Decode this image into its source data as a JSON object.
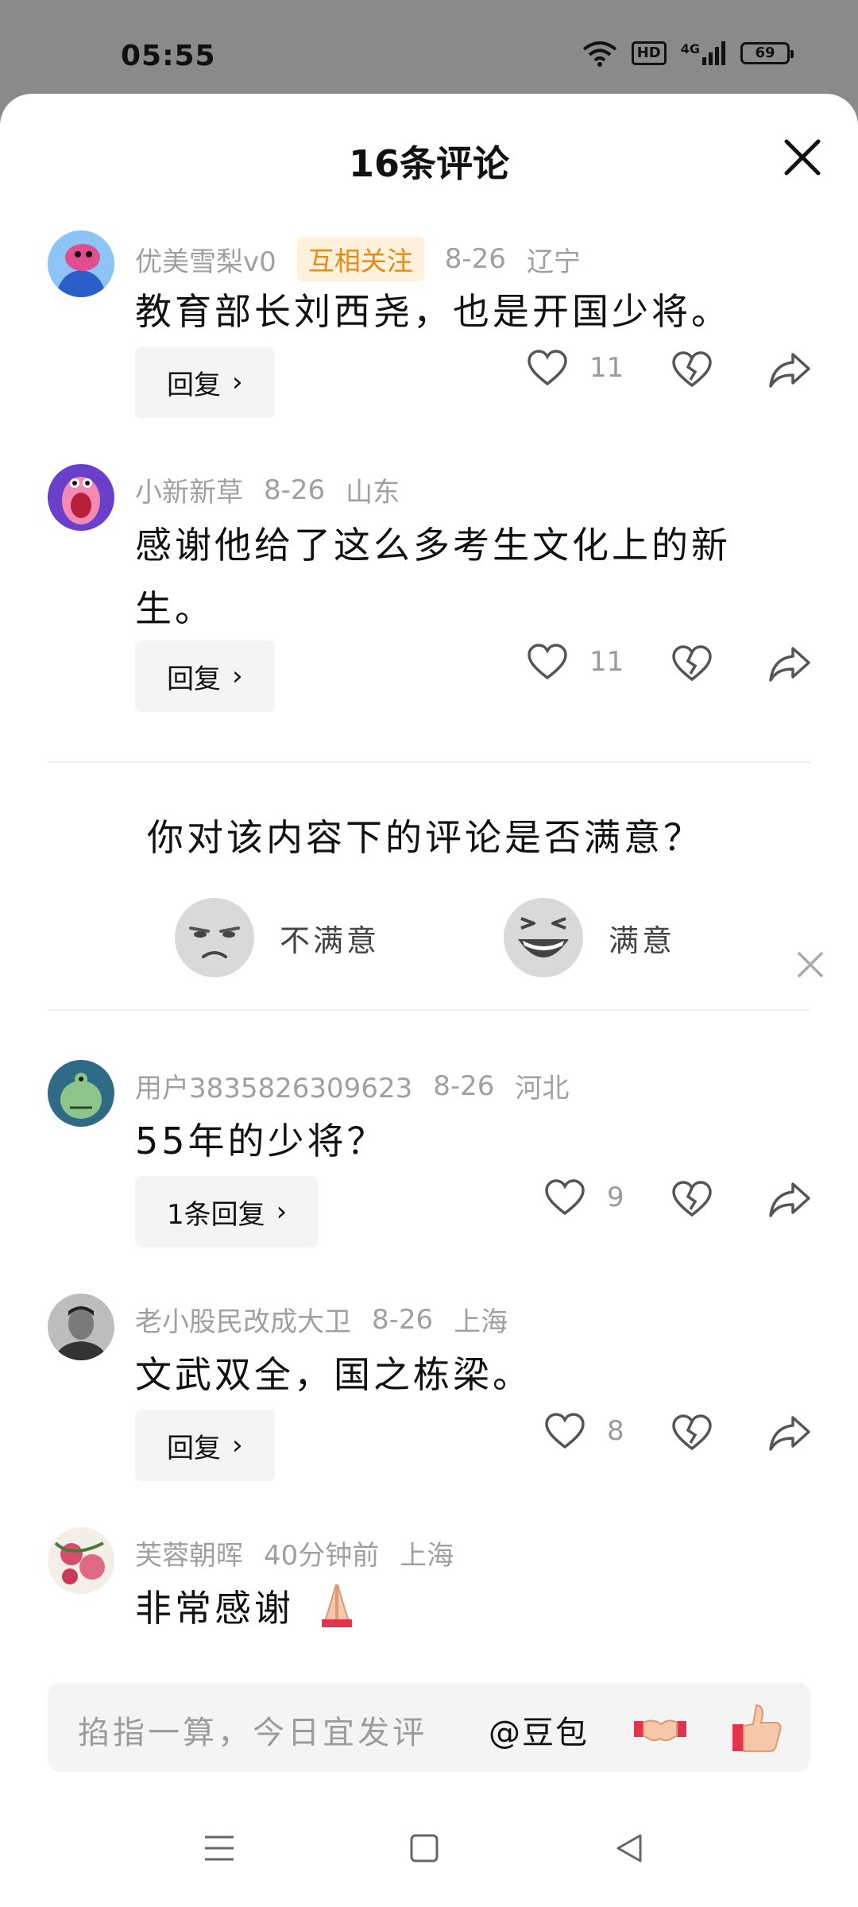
{
  "status_bar": {
    "time": "05:55",
    "hd": "HD",
    "network": "4G",
    "battery": "69"
  },
  "header": {
    "title": "16条评论"
  },
  "comments": [
    {
      "username": "优美雪梨v0",
      "badge": "互相关注",
      "date": "8-26",
      "location": "辽宁",
      "text": "教育部长刘西尧，也是开国少将。",
      "reply_label": "回复",
      "likes": "11"
    },
    {
      "username": "小新新草",
      "date": "8-26",
      "location": "山东",
      "text": "感谢他给了这么多考生文化上的新生。",
      "reply_label": "回复",
      "likes": "11"
    },
    {
      "username": "用户3835826309623",
      "date": "8-26",
      "location": "河北",
      "text": "55年的少将？",
      "reply_label": "1条回复",
      "likes": "9"
    },
    {
      "username": "老小股民改成大卫",
      "date": "8-26",
      "location": "上海",
      "text": "文武双全，国之栋梁。",
      "reply_label": "回复",
      "likes": "8"
    },
    {
      "username": "芙蓉朝晖",
      "date": "40分钟前",
      "location": "上海",
      "text": "非常感谢"
    }
  ],
  "survey": {
    "question": "你对该内容下的评论是否满意？",
    "option_bad": "不满意",
    "option_good": "满意"
  },
  "composer": {
    "placeholder": "掐指一算，今日宜发评",
    "mention": "@豆包"
  },
  "icons": {
    "close": "close-icon",
    "like": "heart-icon",
    "dislike": "broken-heart-icon",
    "share": "share-icon",
    "handshake": "handshake-emoji",
    "thumbs_up": "thumbs-up-emoji",
    "prayer": "folded-hands-emoji"
  },
  "colors": {
    "badge_text": "#e58a16",
    "badge_bg": "#fff1dc",
    "meta": "#a0a0a0"
  }
}
